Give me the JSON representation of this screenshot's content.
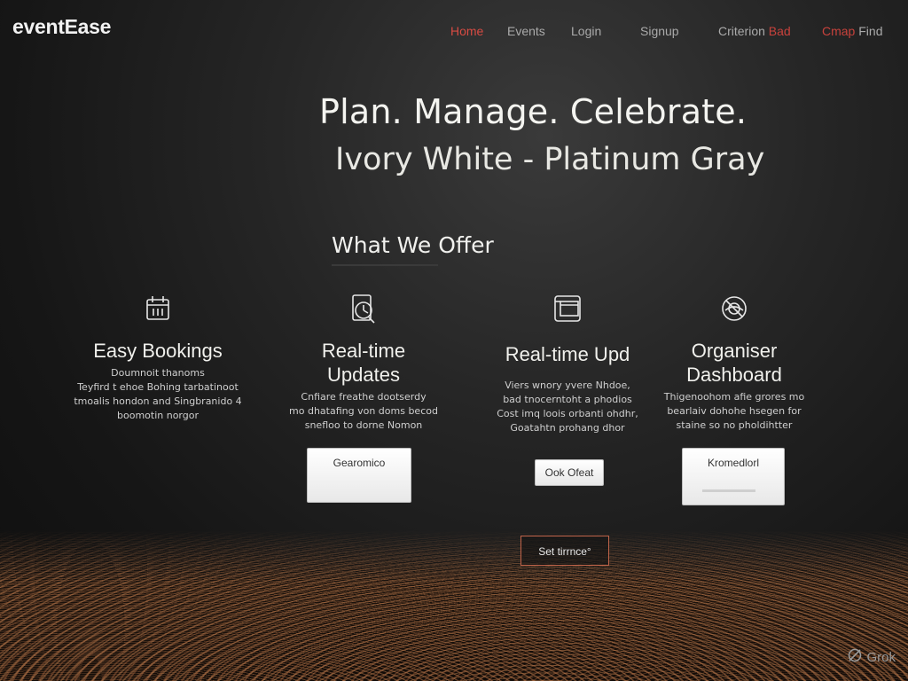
{
  "brand": {
    "name": "eventEase"
  },
  "nav": {
    "home": "Home",
    "events": "Events",
    "login": "Login",
    "signup": "Signup",
    "criterion_prefix": "Criterion",
    "criterion_accent": "Bad",
    "cmap_accent": "Cmap",
    "cmap_suffix": "Find"
  },
  "hero": {
    "title": "Plan. Manage. Celebrate.",
    "subtitle": "Ivory White - Platinum Gray"
  },
  "offer": {
    "title": "What We Offer",
    "features": [
      {
        "icon": "calendar-icon",
        "title": "Easy Bookings",
        "desc": "Doumnoit thanoms\nTeyfird t ehoe Bohing tarbatinoot\ntmoalis hondon and Singbranido 4\nboomotin norgor"
      },
      {
        "icon": "clock-icon",
        "title": "Real-time\nUpdates",
        "desc": "Cnfiare freathe dootserdy\nmo dhatafing von doms becod\nsnefloo to dorne Nomon",
        "button": "Gearomico"
      },
      {
        "icon": "document-icon",
        "title": "Real-time Upd",
        "desc": "Viers wnory yvere Nhdoe,\nbad tnocerntoht a phodios\nCost imq loois orbanti ohdhr,\nGoatahtn prohang dhor",
        "button": "Ook Ofeat"
      },
      {
        "icon": "dashboard-icon",
        "title": "Organiser\nDashboard",
        "desc": "Thigenoohom afie grores mo\nbearlaiv dohohe hsegen for\nstaine so no pholdihtter",
        "button": "Kromedlorl"
      }
    ]
  },
  "cta": {
    "label": "Set tirrnce°"
  },
  "watermark": {
    "text": "Grok"
  },
  "colors": {
    "accent": "#d84b43",
    "background": "#1e1e1e",
    "text": "#f4f4f0",
    "terrain": "#b0704a"
  }
}
